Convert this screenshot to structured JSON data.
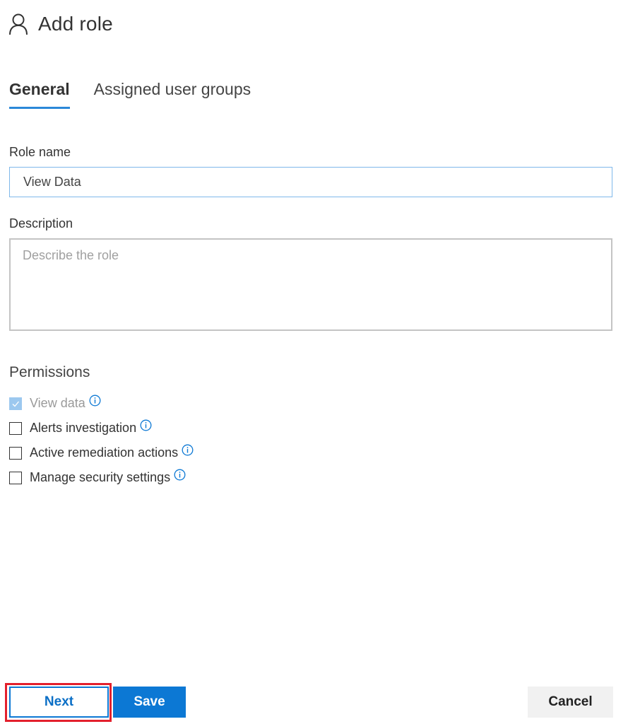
{
  "header": {
    "icon": "person-icon",
    "title": "Add role"
  },
  "tabs": [
    {
      "label": "General",
      "active": true
    },
    {
      "label": "Assigned user groups",
      "active": false
    }
  ],
  "form": {
    "role_name": {
      "label": "Role name",
      "value": "View Data"
    },
    "description": {
      "label": "Description",
      "value": "",
      "placeholder": "Describe the role"
    }
  },
  "permissions": {
    "heading": "Permissions",
    "items": [
      {
        "label": "View data",
        "checked": true,
        "disabled": true,
        "info_icon": "info-icon"
      },
      {
        "label": "Alerts investigation",
        "checked": false,
        "disabled": false,
        "info_icon": "info-icon"
      },
      {
        "label": "Active remediation actions",
        "checked": false,
        "disabled": false,
        "info_icon": "info-icon"
      },
      {
        "label": "Manage security settings",
        "checked": false,
        "disabled": false,
        "info_icon": "info-icon"
      }
    ]
  },
  "footer": {
    "next_label": "Next",
    "save_label": "Save",
    "cancel_label": "Cancel"
  },
  "colors": {
    "accent": "#0c78d4",
    "tab_underline": "#2b88d8",
    "highlight_border": "#e3202d",
    "disabled_check": "#9cc8ef"
  }
}
